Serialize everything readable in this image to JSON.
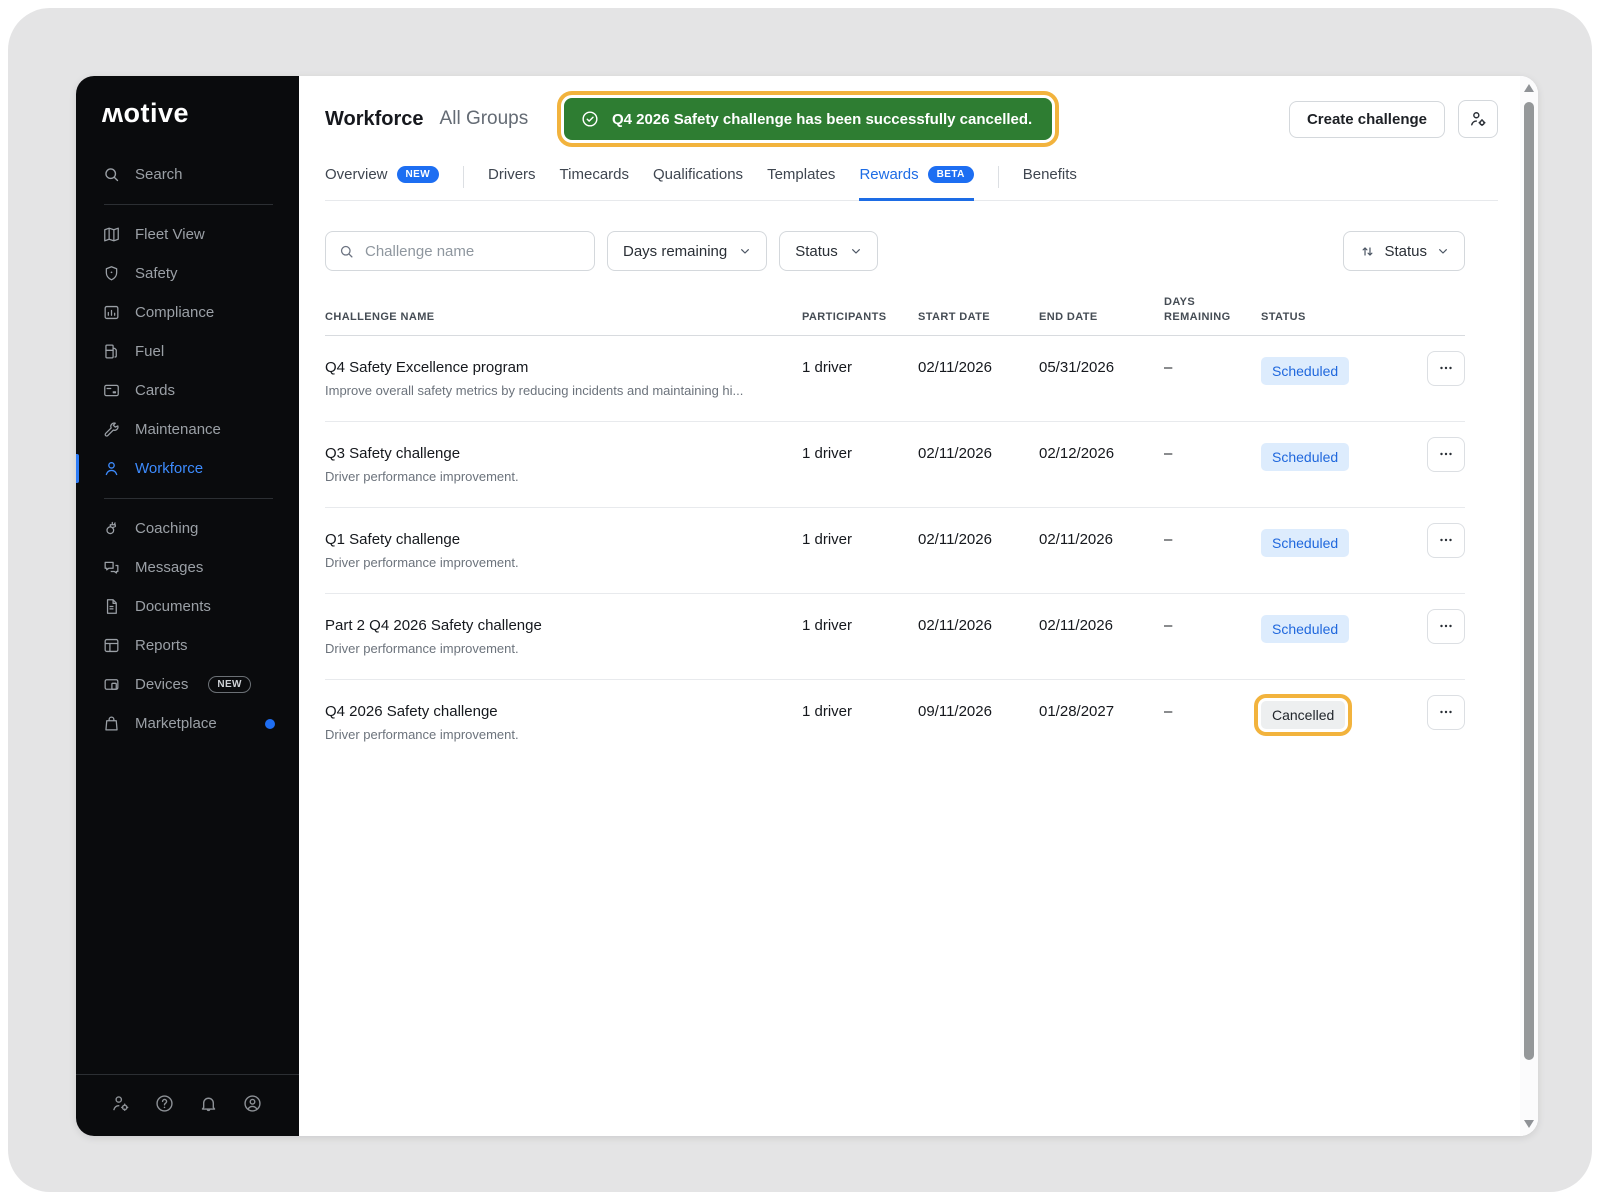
{
  "brand": {
    "logo_text": "ʍotive"
  },
  "colors": {
    "accent_blue": "#1d6ce5",
    "toast_green": "#2e7d32",
    "highlight_ring": "#f2b33d",
    "sidebar_bg": "#0a0b0d",
    "scheduled_bg": "#ddecfd",
    "scheduled_text": "#2068dd",
    "cancelled_bg": "#edeff0",
    "cancelled_text": "#1f242a"
  },
  "sidebar": {
    "search_label": "Search",
    "groups": [
      {
        "items": [
          {
            "label": "Fleet View"
          },
          {
            "label": "Safety"
          },
          {
            "label": "Compliance"
          },
          {
            "label": "Fuel"
          },
          {
            "label": "Cards"
          },
          {
            "label": "Maintenance"
          },
          {
            "label": "Workforce",
            "active": true
          }
        ]
      },
      {
        "items": [
          {
            "label": "Coaching"
          },
          {
            "label": "Messages"
          },
          {
            "label": "Documents"
          },
          {
            "label": "Reports"
          },
          {
            "label": "Devices",
            "badge": "NEW"
          },
          {
            "label": "Marketplace",
            "dot": true
          }
        ]
      }
    ]
  },
  "header": {
    "title": "Workforce",
    "group_label": "All Groups",
    "create_button": "Create challenge"
  },
  "toast": {
    "message": "Q4 2026 Safety challenge has been successfully cancelled."
  },
  "tabs": {
    "items": [
      {
        "label": "Overview",
        "badge": "NEW"
      },
      {
        "label": "Drivers"
      },
      {
        "label": "Timecards"
      },
      {
        "label": "Qualifications"
      },
      {
        "label": "Templates"
      },
      {
        "label": "Rewards",
        "badge": "BETA",
        "active": true
      },
      {
        "label": "Benefits"
      }
    ]
  },
  "filters": {
    "search_placeholder": "Challenge name",
    "days_remaining_label": "Days remaining",
    "status_label": "Status"
  },
  "sort": {
    "label": "Status"
  },
  "table": {
    "columns": [
      "CHALLENGE NAME",
      "PARTICIPANTS",
      "START DATE",
      "END DATE",
      "DAYS REMAINING",
      "STATUS"
    ],
    "rows": [
      {
        "name": "Q4 Safety Excellence program",
        "description": "Improve overall safety metrics by reducing incidents and maintaining hi...",
        "participants": "1 driver",
        "start_date": "02/11/2026",
        "end_date": "05/31/2026",
        "days_remaining": "–",
        "status": "Scheduled",
        "status_style": "scheduled",
        "highlighted": false
      },
      {
        "name": "Q3 Safety challenge",
        "description": "Driver performance improvement.",
        "participants": "1 driver",
        "start_date": "02/11/2026",
        "end_date": "02/12/2026",
        "days_remaining": "–",
        "status": "Scheduled",
        "status_style": "scheduled",
        "highlighted": false
      },
      {
        "name": "Q1 Safety challenge",
        "description": "Driver performance improvement.",
        "participants": "1 driver",
        "start_date": "02/11/2026",
        "end_date": "02/11/2026",
        "days_remaining": "–",
        "status": "Scheduled",
        "status_style": "scheduled",
        "highlighted": false
      },
      {
        "name": "Part 2 Q4 2026 Safety challenge",
        "description": "Driver performance improvement.",
        "participants": "1 driver",
        "start_date": "02/11/2026",
        "end_date": "02/11/2026",
        "days_remaining": "–",
        "status": "Scheduled",
        "status_style": "scheduled",
        "highlighted": false
      },
      {
        "name": "Q4 2026 Safety challenge",
        "description": "Driver performance improvement.",
        "participants": "1 driver",
        "start_date": "09/11/2026",
        "end_date": "01/28/2027",
        "days_remaining": "–",
        "status": "Cancelled",
        "status_style": "cancelled",
        "highlighted": true
      }
    ]
  }
}
